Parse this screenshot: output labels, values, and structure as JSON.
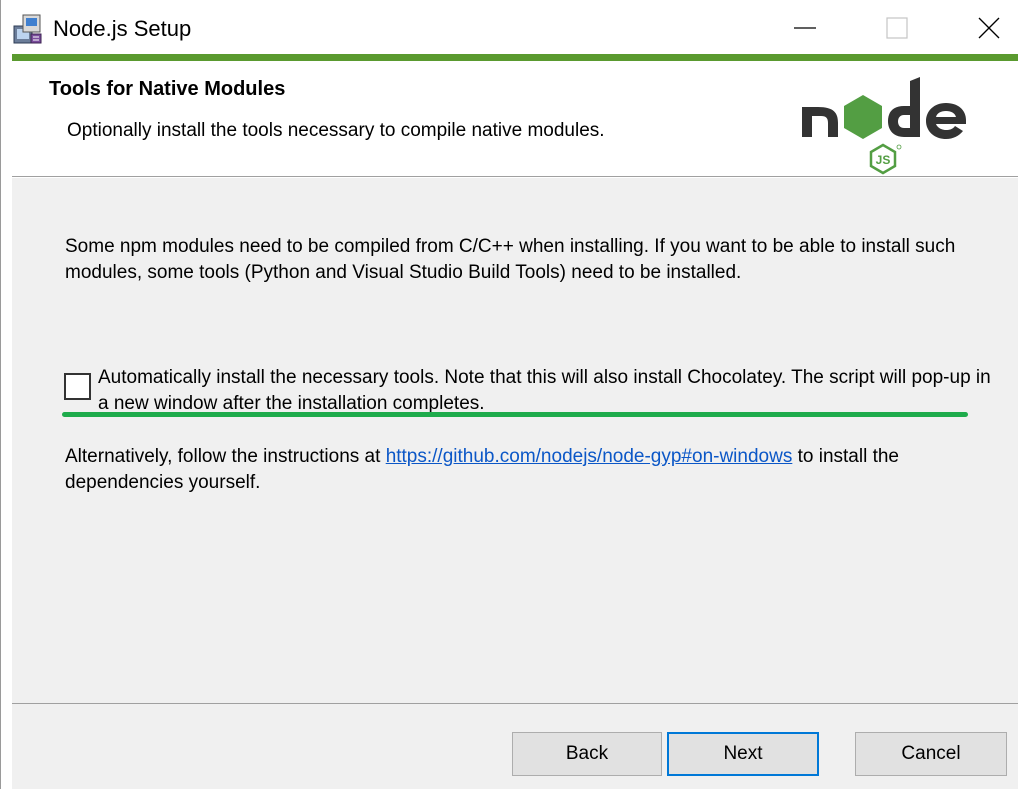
{
  "window": {
    "title": "Node.js Setup",
    "controls": {
      "minimize": "—",
      "maximize": "☐",
      "close": "✕"
    }
  },
  "header": {
    "title": "Tools for Native Modules",
    "description": "Optionally install the tools necessary to compile native modules.",
    "logo": {
      "wordmark": "node",
      "badge": "JS"
    }
  },
  "body": {
    "intro": "Some npm modules need to be compiled from C/C++ when installing. If you want to be able to install such modules, some tools (Python and Visual Studio Build Tools) need to be installed.",
    "auto_install": {
      "checked": false,
      "label": "Automatically install the necessary tools. Note that this will also install Chocolatey. The script will pop-up in a new window after the installation completes."
    },
    "alternative": {
      "before": "Alternatively, follow the instructions at ",
      "link": "https://github.com/nodejs/node-gyp#on-windows",
      "after": " to install the dependencies yourself."
    }
  },
  "footer": {
    "back_label": "Back",
    "next_label": "Next",
    "cancel_label": "Cancel"
  },
  "colors": {
    "title_accent": "#5a9a2f",
    "highlight_underline": "#1eab4b",
    "link": "#0b57c7",
    "default_button_border": "#0078d7",
    "node_green": "#539e43",
    "node_dark": "#333333"
  },
  "icons": [
    "installer-app-icon",
    "minimize-icon",
    "maximize-icon",
    "close-icon",
    "checkbox-icon"
  ]
}
